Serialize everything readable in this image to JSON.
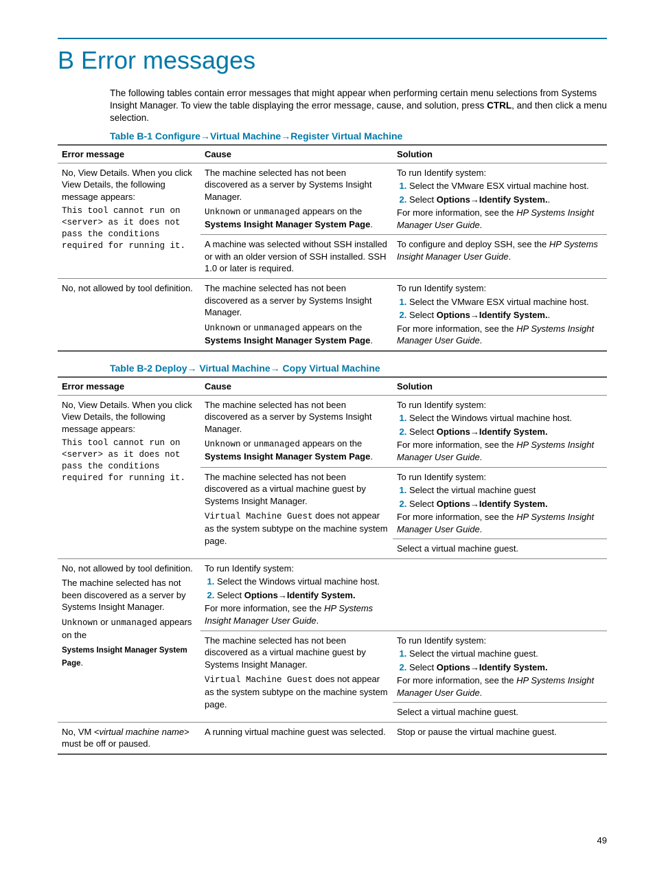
{
  "title": "B Error messages",
  "intro_parts": {
    "p1": "The following tables contain error messages that might appear when performing certain menu selections from Systems Insight Manager. To view the table displaying the error message, cause, and solution, press ",
    "ctrl": "CTRL",
    "p2": ", and then click a menu selection."
  },
  "table1": {
    "caption_parts": [
      "Table B-1  Configure",
      "→",
      "Virtual Machine",
      "→",
      "Register Virtual Machine"
    ],
    "headers": [
      "Error message",
      "Cause",
      "Solution"
    ],
    "rows": [
      {
        "err": {
          "pre": "No, View Details. When you click View Details, the following message appears:",
          "mono": "This tool cannot run on <server> as it does not pass the conditions required for running it."
        },
        "cause": {
          "l1": "The machine selected has not been discovered as a server by Systems Insight Manager.",
          "l2a": "Unknown",
          "l2b": " or ",
          "l2c": "unmanaged",
          "l2d": " appears on the ",
          "l2e": "Systems Insight Manager System Page",
          "l2f": "."
        },
        "sol": {
          "intro": "To run Identify system:",
          "step1": "Select the VMware ESX virtual machine host.",
          "step2a": "Select ",
          "step2b": "Options",
          "step2c": "→",
          "step2d": "Identify System.",
          "step2e": ".",
          "post_a": "For more information, see the ",
          "post_b": "HP Systems Insight Manager User Guide",
          "post_c": "."
        }
      },
      {
        "err": "",
        "cause": "A machine was selected without SSH installed or with an older version of SSH installed. SSH 1.0 or later is required.",
        "sol": {
          "a": "To configure and deploy SSH, see the ",
          "b": "HP Systems Insight Manager User Guide",
          "c": "."
        }
      },
      {
        "err": "No, not allowed by tool definition.",
        "cause": {
          "l1": "The machine selected has not been discovered as a server by Systems Insight Manager.",
          "l2a": "Unknown",
          "l2b": " or ",
          "l2c": "unmanaged",
          "l2d": " appears on the ",
          "l2e": "Systems Insight Manager System Page",
          "l2f": "."
        },
        "sol": {
          "intro": "To run Identify system:",
          "step1": "Select the VMware ESX virtual machine host.",
          "step2a": "Select ",
          "step2b": "Options",
          "step2c": "→",
          "step2d": "Identify System.",
          "step2e": ".",
          "post_a": "For more information, see the ",
          "post_b": "HP Systems Insight Manager User Guide",
          "post_c": "."
        }
      }
    ]
  },
  "table2": {
    "caption_parts": [
      "Table B-2  Deploy",
      "→",
      " Virtual Machine",
      "→",
      " Copy Virtual Machine"
    ],
    "headers": [
      "Error message",
      "Cause",
      "Solution"
    ],
    "r1": {
      "err": {
        "pre": "No, View Details. When you click View Details, the following message appears:",
        "mono": "This tool cannot run on <server> as it does not pass the conditions required for running it."
      },
      "cause1": {
        "l1": "The machine selected has not been discovered as a server by Systems Insight Manager.",
        "l2a": "Unknown",
        "l2b": " or ",
        "l2c": "unmanaged",
        "l2d": " appears on the ",
        "l2e": "Systems Insight Manager System Page",
        "l2f": "."
      },
      "sol1": {
        "intro": "To run Identify system:",
        "step1": "Select the Windows virtual machine host.",
        "step2a": "Select ",
        "step2b": "Options",
        "step2c": "→",
        "step2d": "Identify System.",
        "post_a": "For more information, see the ",
        "post_b": "HP Systems Insight Manager User Guide",
        "post_c": "."
      },
      "cause2": {
        "l1": "The machine selected has not been discovered as a virtual machine guest by Systems Insight Manager.",
        "l2a": "Virtual Machine Guest",
        "l2b": " does not appear as the system subtype on the machine system page."
      },
      "sol2": {
        "intro": "To run Identify system:",
        "step1": "Select the virtual machine guest",
        "step2a": "Select ",
        "step2b": "Options",
        "step2c": "→",
        "step2d": "Identify System.",
        "post_a": "For more information, see the ",
        "post_b": "HP Systems Insight Manager User Guide",
        "post_c": "."
      },
      "sol3": "Select a virtual machine guest."
    },
    "r2": {
      "err": {
        "l1": "No, not allowed by tool definition.",
        "l2": "The machine selected has not been discovered as a server by Systems Insight Manager.",
        "l3a": "Unknown",
        "l3b": " or ",
        "l3c": "unmanaged",
        "l3d": " appears on the",
        "l4": "Systems Insight Manager System Page",
        "l4b": "."
      },
      "cause1": {
        "intro": "To run Identify system:",
        "step1": "Select the Windows virtual machine host.",
        "step2a": "Select ",
        "step2b": "Options",
        "step2c": "→",
        "step2d": "Identify System.",
        "post_a": "For more information, see the ",
        "post_b": "HP Systems Insight Manager User Guide",
        "post_c": "."
      },
      "cause2": {
        "l1": "The machine selected has not been discovered as a virtual machine guest by Systems Insight Manager.",
        "l2a": "Virtual Machine Guest",
        "l2b": " does not appear as the system subtype on the machine system page."
      },
      "sol2": {
        "intro": "To run Identify system:",
        "step1": "Select the virtual machine guest.",
        "step2a": "Select ",
        "step2b": "Options",
        "step2c": "→",
        "step2d": "Identify System.",
        "post_a": "For more information, see the ",
        "post_b": "HP Systems Insight Manager User Guide",
        "post_c": "."
      },
      "sol3": "Select a virtual machine guest."
    },
    "r3": {
      "err_a": "No, VM <",
      "err_b": "virtual machine name",
      "err_c": "> must be off or paused.",
      "cause": "A running virtual machine guest was selected.",
      "sol": "Stop or pause the virtual machine guest."
    }
  },
  "page_number": "49"
}
